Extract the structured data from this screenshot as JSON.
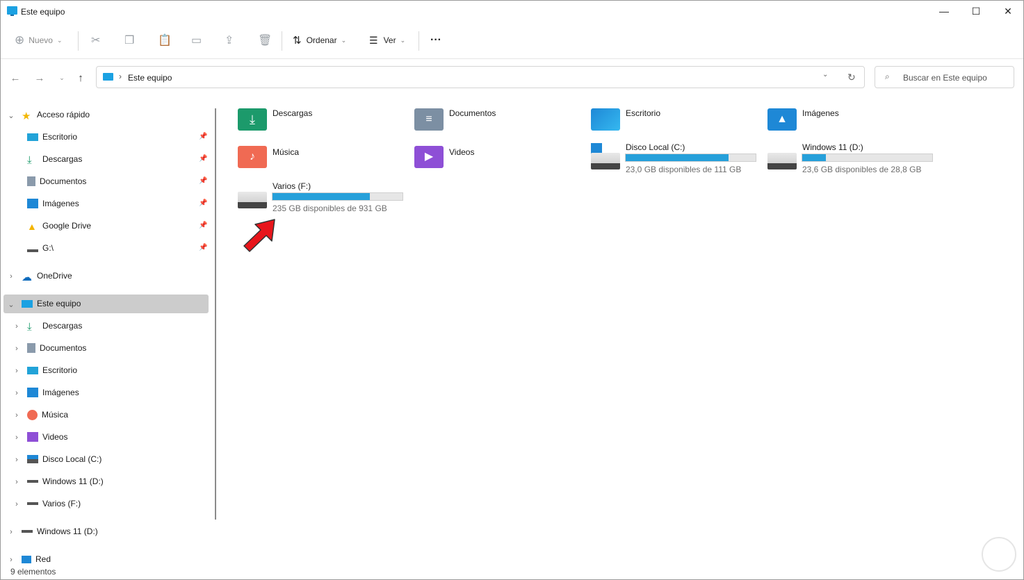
{
  "window": {
    "title": "Este equipo",
    "minimize": "—",
    "maximize": "☐",
    "close": "✕"
  },
  "toolbar": {
    "nuevo": "Nuevo",
    "ordenar": "Ordenar",
    "ver": "Ver",
    "more": "···",
    "icons": [
      "cut-icon",
      "copy-icon",
      "paste-icon",
      "rename-icon",
      "share-icon",
      "delete-icon"
    ]
  },
  "address": {
    "path": "Este equipo",
    "separator": "›"
  },
  "search": {
    "placeholder": "Buscar en Este equipo"
  },
  "sidebar": {
    "quick_access": {
      "label": "Acceso rápido",
      "items": [
        {
          "label": "Escritorio",
          "icon": "desktop-icon"
        },
        {
          "label": "Descargas",
          "icon": "download-icon"
        },
        {
          "label": "Documentos",
          "icon": "document-icon"
        },
        {
          "label": "Imágenes",
          "icon": "image-icon"
        },
        {
          "label": "Google Drive",
          "icon": "google-drive-icon"
        },
        {
          "label": "G:\\",
          "icon": "drive-icon"
        }
      ]
    },
    "onedrive": "OneDrive",
    "this_pc": {
      "label": "Este equipo",
      "items": [
        {
          "label": "Descargas",
          "icon": "download-icon"
        },
        {
          "label": "Documentos",
          "icon": "document-icon"
        },
        {
          "label": "Escritorio",
          "icon": "desktop-icon"
        },
        {
          "label": "Imágenes",
          "icon": "image-icon"
        },
        {
          "label": "Música",
          "icon": "music-icon"
        },
        {
          "label": "Videos",
          "icon": "video-icon"
        },
        {
          "label": "Disco Local (C:)",
          "icon": "windows-drive-icon"
        },
        {
          "label": "Windows 11 (D:)",
          "icon": "drive-icon"
        },
        {
          "label": "Varios (F:)",
          "icon": "drive-icon"
        }
      ]
    },
    "windows11": "Windows 11 (D:)",
    "network": "Red"
  },
  "content": {
    "folders": [
      {
        "label": "Descargas",
        "color": "#1c9a6b"
      },
      {
        "label": "Documentos",
        "color": "#7c8fa3"
      },
      {
        "label": "Escritorio",
        "color": "#1e88d6"
      },
      {
        "label": "Imágenes",
        "color": "#1e88d6"
      },
      {
        "label": "Música",
        "color": "#f06a53"
      },
      {
        "label": "Videos",
        "color": "#8e4fd6"
      }
    ],
    "drives": [
      {
        "label": "Disco Local (C:)",
        "free": "23,0 GB disponibles de 111 GB",
        "used_fraction": 0.79
      },
      {
        "label": "Windows 11 (D:)",
        "free": "23,6 GB disponibles de 28,8 GB",
        "used_fraction": 0.18
      },
      {
        "label": "Varios (F:)",
        "free": "235 GB disponibles de 931 GB",
        "used_fraction": 0.75
      }
    ]
  },
  "status": {
    "count": "9 elementos"
  },
  "colors": {
    "accent": "#26a0da",
    "selection": "#cccccc",
    "arrow": "#e8151b"
  }
}
